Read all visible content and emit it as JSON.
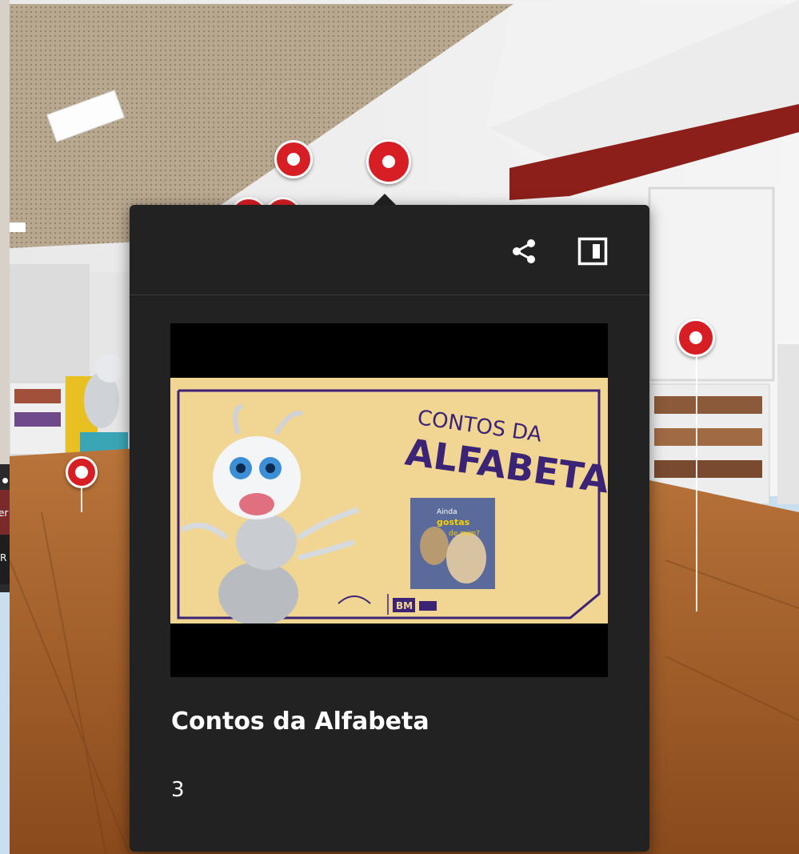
{
  "left_panel": {
    "band_text": "er",
    "dark_text": "R"
  },
  "hotspot_card": {
    "title": "Contos da Alfabeta",
    "count": "3",
    "share_icon": "share-icon",
    "panel_icon": "sidebar-panel-icon"
  },
  "thumbnail": {
    "headline_top": "CONTOS DA",
    "headline_main": "ALFABETA",
    "book_line1": "Ainda",
    "book_line2": "gostas",
    "book_line3": "de mim?",
    "logo_bm": "BM"
  },
  "colors": {
    "card_bg": "#222222",
    "pin_red": "#d81e25",
    "thumb_bg": "#f1d593",
    "headline_purple": "#3b2475"
  }
}
